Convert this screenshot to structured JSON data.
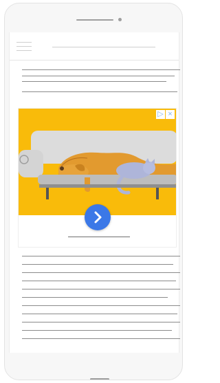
{
  "device": {
    "frame_color": "#f7f7f7",
    "screen_color": "#ffffff"
  },
  "topbar": {
    "menu_icon": "hamburger-menu-icon"
  },
  "ad": {
    "image_description": "dog-and-cat-on-couch-illustration",
    "background_color": "#f9bb0a",
    "cta_color": "#3b78e7",
    "cta_icon": "chevron-right-icon",
    "badges": {
      "adchoices_icon": "adchoices-icon",
      "close_icon": "close-icon"
    }
  }
}
